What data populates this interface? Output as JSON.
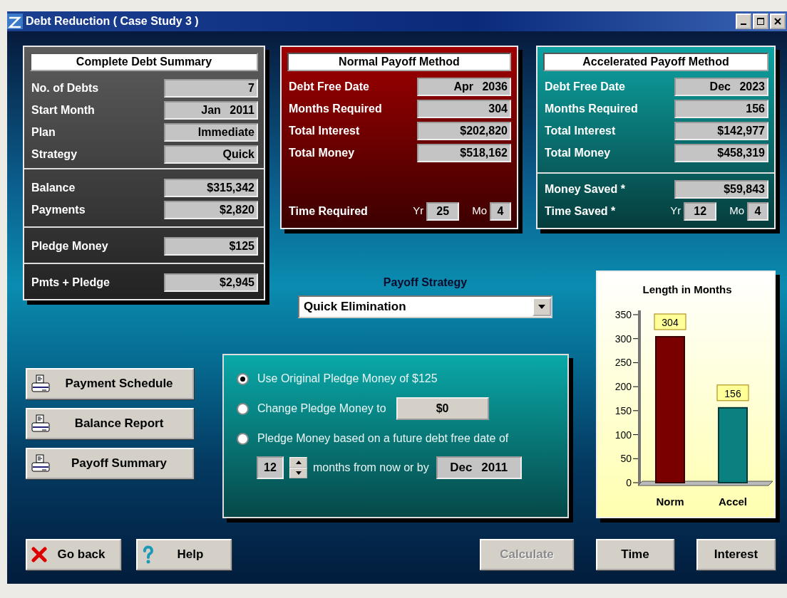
{
  "window": {
    "title": "Debt Reduction ( Case Study 3 )"
  },
  "summary": {
    "title": "Complete Debt Summary",
    "groups": [
      [
        {
          "label": "No. of Debts",
          "value": "7"
        },
        {
          "label": "Start Month",
          "value": "Jan 2011"
        },
        {
          "label": "Plan",
          "value": "Immediate"
        },
        {
          "label": "Strategy",
          "value": "Quick"
        }
      ],
      [
        {
          "label": "Balance",
          "value": "$315,342"
        },
        {
          "label": "Payments",
          "value": "$2,820"
        }
      ],
      [
        {
          "label": "Pledge Money",
          "value": "$125"
        }
      ],
      [
        {
          "label": "Pmts + Pledge",
          "value": "$2,945"
        }
      ]
    ]
  },
  "methods": [
    {
      "kind": "normal",
      "title": "Normal Payoff Method",
      "rows": [
        {
          "label": "Debt Free Date",
          "value": "Apr 2036"
        },
        {
          "label": "Months Required",
          "value": "304"
        },
        {
          "label": "Total Interest",
          "value": "$202,820"
        },
        {
          "label": "Total Money",
          "value": "$518,162"
        }
      ],
      "time": {
        "label": "Time Required",
        "yr_label": "Yr",
        "years": "25",
        "mo_label": "Mo",
        "months": "4"
      }
    },
    {
      "kind": "accelerated",
      "title": "Accelerated Payoff Method",
      "rows": [
        {
          "label": "Debt Free Date",
          "value": "Dec 2023"
        },
        {
          "label": "Months Required",
          "value": "156"
        },
        {
          "label": "Total Interest",
          "value": "$142,977"
        },
        {
          "label": "Total Money",
          "value": "$458,319"
        }
      ],
      "saved": [
        {
          "label": "Money Saved *",
          "value": "$59,843"
        }
      ],
      "time": {
        "label": "Time Saved *",
        "yr_label": "Yr",
        "years": "12",
        "mo_label": "Mo",
        "months": "4"
      }
    }
  ],
  "strategy": {
    "label": "Payoff Strategy",
    "value": "Quick Elimination"
  },
  "pledge_options": [
    {
      "label": "Use Original Pledge Money of $125",
      "selected": true
    },
    {
      "label": "Change Pledge Money to",
      "selected": false,
      "amount": "$0"
    },
    {
      "label": "Pledge Money based on a future debt free date of",
      "selected": false
    }
  ],
  "future": {
    "months": "12",
    "text": "months from now or by",
    "date": "Dec 2011"
  },
  "report_buttons": [
    "Payment Schedule",
    "Balance Report",
    "Payoff Summary"
  ],
  "chart": {
    "chart_data": {
      "type": "bar",
      "title": "Length in Months",
      "categories": [
        "Norm",
        "Accel"
      ],
      "values": [
        304,
        156
      ],
      "ylim": [
        0,
        350
      ],
      "yticks": [
        0,
        50,
        100,
        150,
        200,
        250,
        300,
        350
      ],
      "data_labels": true
    }
  },
  "nav_buttons": [
    {
      "kind": "back",
      "label": "Go back"
    },
    {
      "kind": "help",
      "label": "Help"
    }
  ],
  "action_buttons": [
    {
      "label": "Calculate",
      "disabled": true
    },
    {
      "label": "Time",
      "disabled": false
    },
    {
      "label": "Interest",
      "disabled": false
    }
  ]
}
